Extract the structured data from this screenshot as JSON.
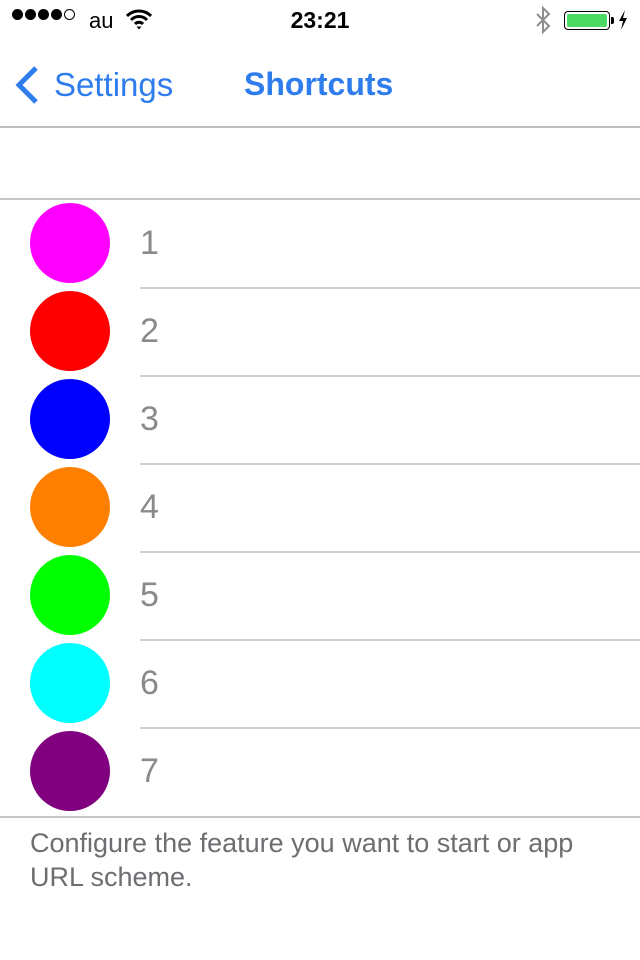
{
  "status_bar": {
    "signal_bars_filled": 4,
    "signal_bars_total": 5,
    "carrier": "au",
    "wifi_icon": "wifi-icon",
    "time": "23:21",
    "bluetooth_icon": "bluetooth-icon",
    "battery_percent": 100,
    "battery_color": "#4cd964",
    "charging": true
  },
  "nav": {
    "back_label": "Settings",
    "title": "Shortcuts",
    "accent_color": "#2f7ded"
  },
  "shortcuts": [
    {
      "label": "1",
      "color": "#ff00ff"
    },
    {
      "label": "2",
      "color": "#ff0000"
    },
    {
      "label": "3",
      "color": "#0000ff"
    },
    {
      "label": "4",
      "color": "#ff8000"
    },
    {
      "label": "5",
      "color": "#00ff00"
    },
    {
      "label": "6",
      "color": "#00ffff"
    },
    {
      "label": "7",
      "color": "#800080"
    }
  ],
  "footer": {
    "text": "Configure the feature you want to start or app URL scheme."
  }
}
